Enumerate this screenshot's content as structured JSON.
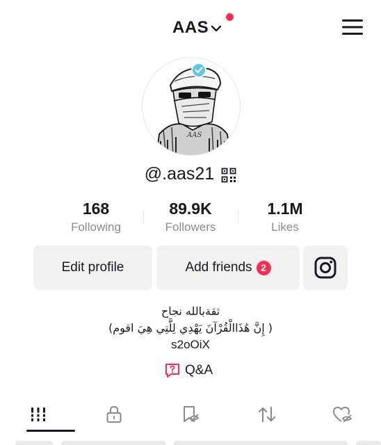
{
  "header": {
    "account_name": "AAS",
    "has_notification": true
  },
  "profile": {
    "username": "@.aas21",
    "verified": true
  },
  "stats": [
    {
      "value": "168",
      "label": "Following"
    },
    {
      "value": "89.9K",
      "label": "Followers"
    },
    {
      "value": "1.1M",
      "label": "Likes"
    }
  ],
  "actions": {
    "edit_profile": "Edit profile",
    "add_friends": "Add friends",
    "add_friends_badge": "2",
    "instagram_icon": "instagram-icon"
  },
  "bio": {
    "line1": "ثقةبالله نجاح",
    "line2": "( إِنَّ هَٰذَاالْقُرْآنَ يَهْدِي لِلَّتِي هِيَ اقوم)",
    "line3": "s2oOiX"
  },
  "qa": {
    "label": "Q&A",
    "icon": "question-box-icon"
  },
  "tabs": [
    {
      "icon": "videos-grid-icon",
      "active": true
    },
    {
      "icon": "lock-icon",
      "active": false
    },
    {
      "icon": "favorites-hidden-icon",
      "active": false
    },
    {
      "icon": "repost-icon",
      "active": false
    },
    {
      "icon": "liked-hidden-icon",
      "active": false
    }
  ],
  "colors": {
    "accent": "#fe2c55",
    "verified": "#5ec7e6",
    "text": "#161823",
    "muted": "#8a8b91",
    "button_bg": "#f1f1f2"
  }
}
